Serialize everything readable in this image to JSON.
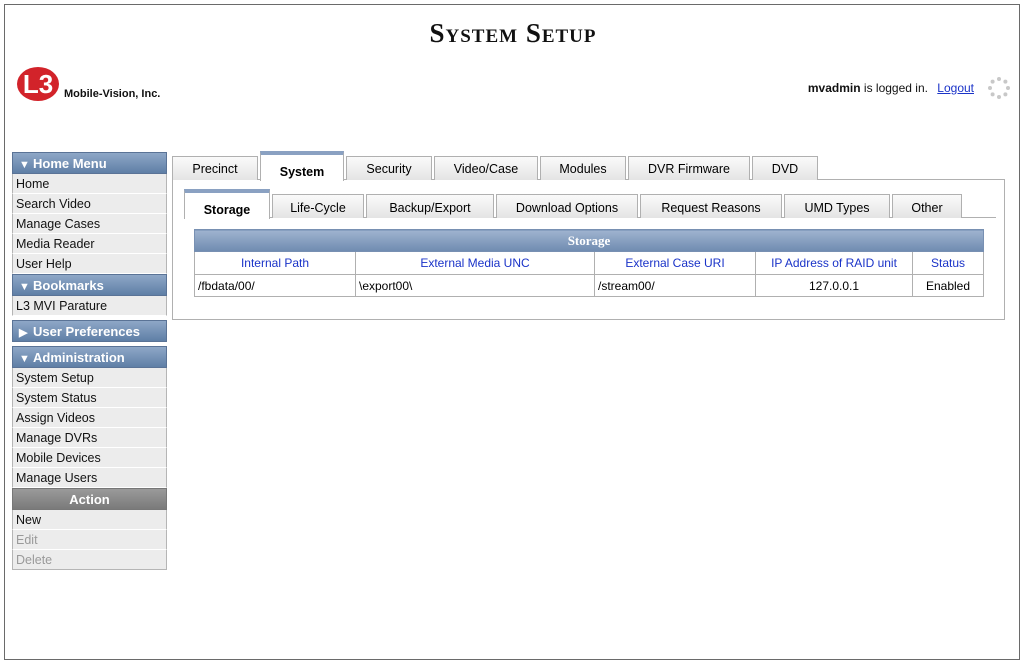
{
  "header": {
    "title": "System Setup",
    "company": "Mobile-Vision, Inc.",
    "logo_text": "L3",
    "user": "mvadmin",
    "login_suffix": "is logged in.",
    "logout_label": "Logout"
  },
  "sidebar": {
    "home_menu": {
      "title": "Home Menu",
      "items": [
        "Home",
        "Search Video",
        "Manage Cases",
        "Media Reader",
        "User Help"
      ]
    },
    "bookmarks": {
      "title": "Bookmarks",
      "items": [
        "L3 MVI Parature"
      ]
    },
    "user_preferences": {
      "title": "User Preferences"
    },
    "administration": {
      "title": "Administration",
      "items": [
        "System Setup",
        "System Status",
        "Assign Videos",
        "Manage DVRs",
        "Mobile Devices",
        "Manage Users"
      ]
    },
    "action": {
      "title": "Action",
      "items": [
        "New",
        "Edit",
        "Delete"
      ]
    }
  },
  "tabs": [
    "Precinct",
    "System",
    "Security",
    "Video/Case",
    "Modules",
    "DVR Firmware",
    "DVD"
  ],
  "active_tab": "System",
  "subtabs": [
    "Storage",
    "Life-Cycle",
    "Backup/Export",
    "Download Options",
    "Request Reasons",
    "UMD Types",
    "Other"
  ],
  "active_subtab": "Storage",
  "table": {
    "caption": "Storage",
    "columns": [
      "Internal Path",
      "External Media UNC",
      "External Case URI",
      "IP Address of RAID unit",
      "Status"
    ],
    "rows": [
      [
        "/fbdata/00/",
        "\\export00\\",
        "/stream00/",
        "127.0.0.1",
        "Enabled"
      ]
    ]
  },
  "colors": {
    "menu_header": "#6f8bb0",
    "link": "#1a33c8",
    "logo_red": "#d2232a"
  }
}
